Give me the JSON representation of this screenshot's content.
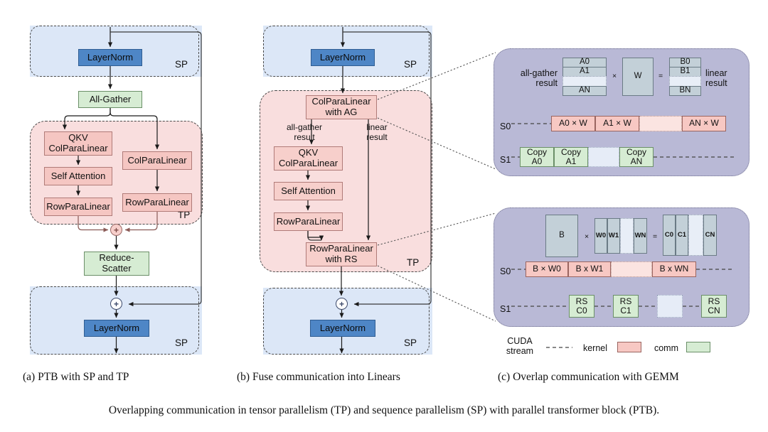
{
  "figure": {
    "caption": "Overlapping communication in tensor parallelism (TP) and sequence parallelism (SP) with parallel transformer block (PTB)."
  },
  "panels": {
    "a": {
      "caption": "(a) PTB with SP and TP",
      "region_sp_top": "SP",
      "region_sp_bottom": "SP",
      "region_tp": "TP",
      "nodes": {
        "layernorm_top": "LayerNorm",
        "all_gather": "All-Gather",
        "qkv_col": "QKV\nColParaLinear",
        "self_attn": "Self Attention",
        "row_left": "RowParaLinear",
        "col_right": "ColParaLinear",
        "row_right": "RowParaLinear",
        "reduce_scatter": "Reduce-\nScatter",
        "layernorm_bottom": "LayerNorm"
      },
      "plus": "+"
    },
    "b": {
      "caption": "(b) Fuse communication into Linears",
      "region_sp_top": "SP",
      "region_sp_bottom": "SP",
      "region_tp": "TP",
      "nodes": {
        "layernorm_top": "LayerNorm",
        "col_with_ag": "ColParaLinear\nwith AG",
        "qkv_col": "QKV\nColParaLinear",
        "self_attn": "Self Attention",
        "row_left": "RowParaLinear",
        "row_with_rs": "RowParaLinear\nwith RS",
        "layernorm_bottom": "LayerNorm"
      },
      "flow_labels": {
        "all_gather_result": "all-gather\nresult",
        "linear_result": "linear\nresult"
      },
      "plus": "+"
    },
    "c": {
      "caption": "(c) Overlap communication with GEMM",
      "top_card": {
        "left_label": "all-gather\nresult",
        "right_label": "linear\nresult",
        "operand_a_cells": [
          "A0",
          "A1",
          "",
          "AN"
        ],
        "operand_w": "W",
        "operand_b_cells": [
          "B0",
          "B1",
          "",
          "BN"
        ],
        "mul_symbol": "×",
        "eq_symbol": "=",
        "stream0_label": "S0",
        "stream1_label": "S1",
        "stream0_cells": [
          "A0 × W",
          "A1 × W",
          "",
          "AN × W"
        ],
        "stream1_cells": [
          "Copy\nA0",
          "Copy\nA1",
          "",
          "Copy\nAN"
        ]
      },
      "bottom_card": {
        "operand_b": "B",
        "weight_cells": [
          "W0",
          "W1",
          "",
          "WN"
        ],
        "result_cells": [
          "C0",
          "C1",
          "",
          "CN"
        ],
        "mul_symbol": "×",
        "eq_symbol": "=",
        "stream0_label": "S0",
        "stream1_label": "S1",
        "stream0_cells": [
          "B × W0",
          "B x W1",
          "",
          "B x WN"
        ],
        "stream1_cells": [
          "RS\nC0",
          "RS\nC1",
          "",
          "RS\nCN"
        ]
      },
      "legend": {
        "cuda_stream": "CUDA\nstream",
        "kernel": "kernel",
        "comm": "comm"
      }
    }
  },
  "colors": {
    "sp_fill": "#dce7f7",
    "tp_fill": "#f9dede",
    "layernorm": "#4e86c6",
    "comm_green": "#d6ecd3",
    "kernel_pink": "#f5c6c2",
    "card_purple": "#b9b9d6",
    "matrix_blue": "#c3d0d8"
  }
}
